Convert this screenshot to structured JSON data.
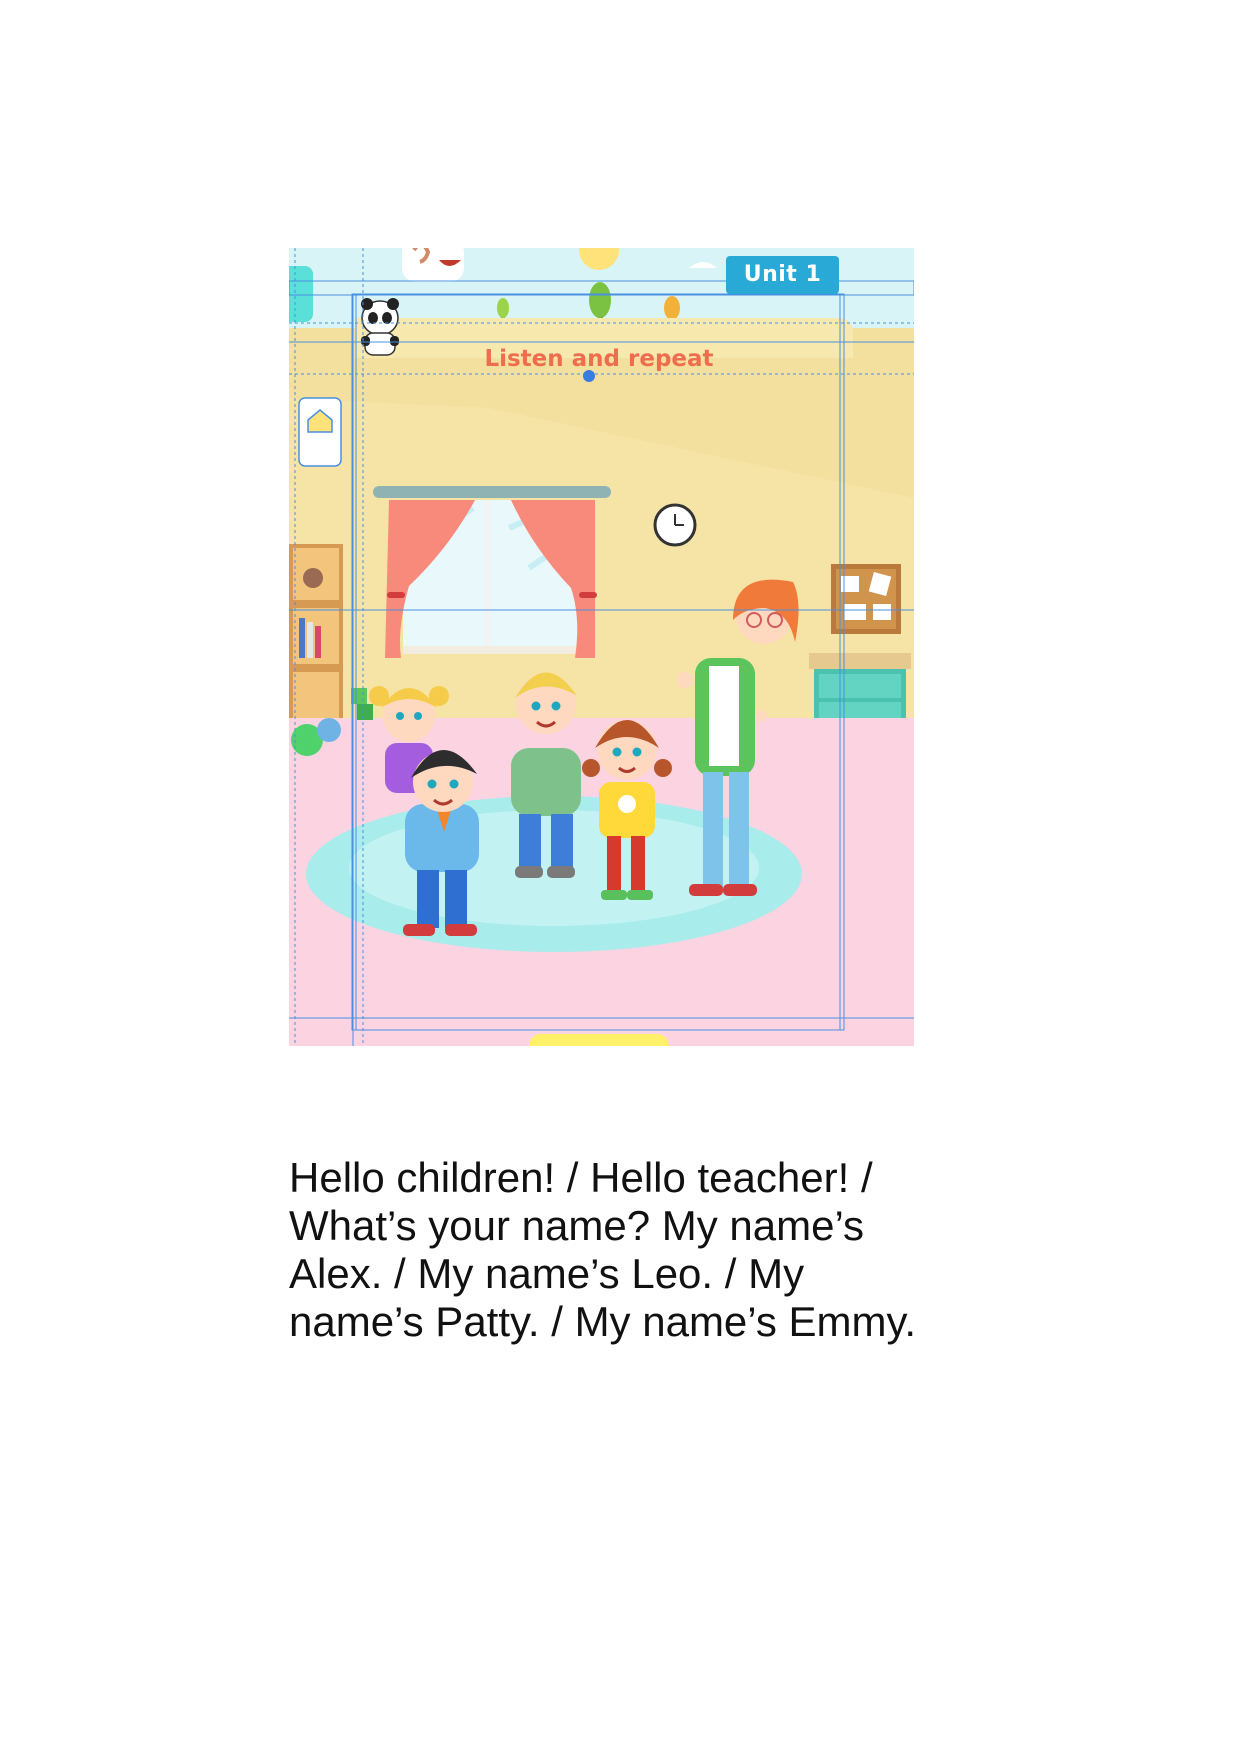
{
  "scene": {
    "unit_label": "Unit 1",
    "instruction": "Listen and repeat",
    "illustration": "classroom-greeting-illustration",
    "colors": {
      "sky": "#d8f4f7",
      "wall": "#f6e4a6",
      "floor": "#fbd3e1",
      "rug": "#a9ecec",
      "curtain": "#f78a7a",
      "badge": "#29a9d6",
      "instruction_text": "#ef6d4f",
      "guide_lines": "#4a90e2"
    }
  },
  "caption": {
    "text": "Hello children! / Hello teacher! / What’s your name? My name’s Alex. / My name’s Leo. / My name’s Patty. / My name’s Emmy."
  }
}
